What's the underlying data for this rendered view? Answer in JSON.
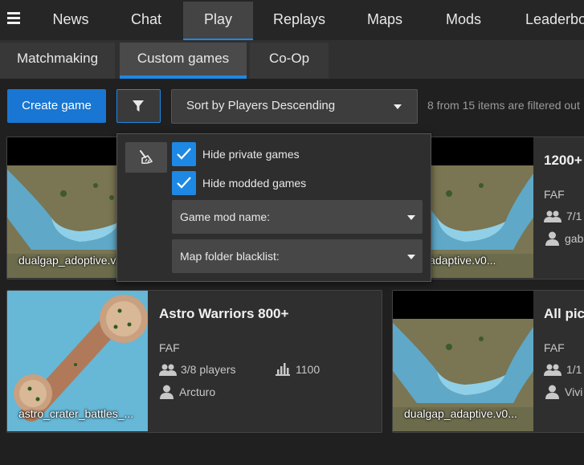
{
  "nav": {
    "menu_icon": "hamburger-icon",
    "tabs": [
      "News",
      "Chat",
      "Play",
      "Replays",
      "Maps",
      "Mods",
      "Leaderboards"
    ],
    "active_tab": "Play"
  },
  "subnav": {
    "tabs": [
      "Matchmaking",
      "Custom games",
      "Co-Op"
    ],
    "active_tab": "Custom games"
  },
  "toolbar": {
    "create_label": "Create game",
    "filter_icon": "funnel-icon",
    "sort_label": "Sort by Players Descending",
    "filter_status": "8 from 15 items are filtered out"
  },
  "filter_popup": {
    "reset_icon": "broom-icon",
    "hide_private_label": "Hide private games",
    "hide_private_checked": true,
    "hide_modded_label": "Hide modded games",
    "hide_modded_checked": true,
    "mod_name_label": "Game mod name:",
    "map_blacklist_label": "Map folder blacklist:"
  },
  "games": [
    {
      "title": "",
      "featured_mod": "",
      "players": "",
      "rating": "",
      "host": "",
      "map": "dualgap_adoptive.v..."
    },
    {
      "title": "1200+",
      "featured_mod": "FAF",
      "players": "7/1",
      "rating": "",
      "host": "gab",
      "map": "gap_adaptive.v0..."
    },
    {
      "title": "Astro Warriors 800+",
      "featured_mod": "FAF",
      "players": "3/8 players",
      "rating": "1100",
      "host": "Arcturo",
      "map": "astro_crater_battles_..."
    },
    {
      "title": "All pic",
      "featured_mod": "FAF",
      "players": "1/1",
      "rating": "",
      "host": "Vivi",
      "map": "dualgap_adaptive.v0..."
    }
  ],
  "colors": {
    "accent": "#1e88e5",
    "background": "#202020",
    "card": "#2f2f2f"
  }
}
